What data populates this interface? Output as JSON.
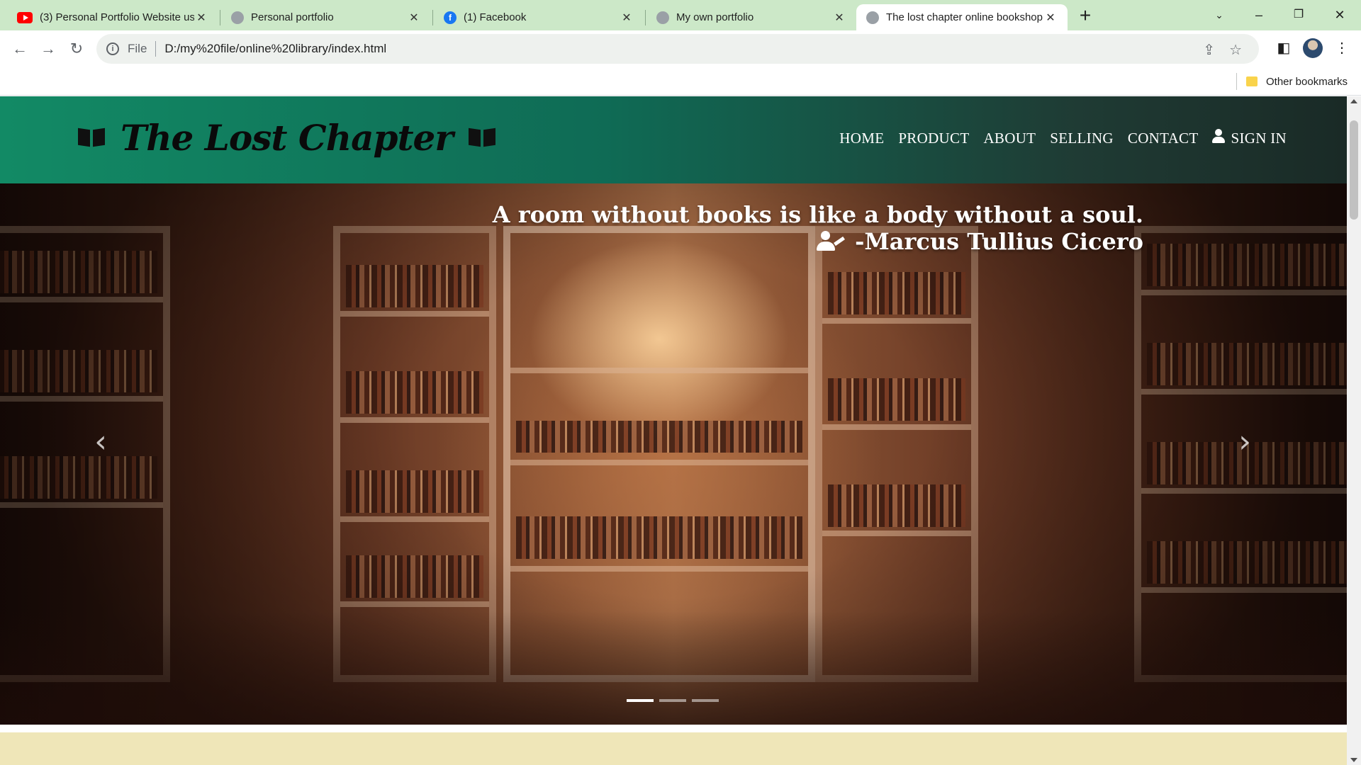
{
  "browser": {
    "tabs": [
      {
        "title": "(3) Personal Portfolio Website usi",
        "favicon": "youtube-icon",
        "active": false
      },
      {
        "title": "Personal portfolio",
        "favicon": "globe-icon",
        "active": false
      },
      {
        "title": "(1) Facebook",
        "favicon": "facebook-icon",
        "active": false
      },
      {
        "title": "My own portfolio",
        "favicon": "globe-icon",
        "active": false
      },
      {
        "title": "The lost chapter online bookshop",
        "favicon": "globe-icon",
        "active": true
      }
    ],
    "address": {
      "scheme": "File",
      "url": "D:/my%20file/online%20library/index.html"
    },
    "bookmarks": {
      "other": "Other bookmarks"
    }
  },
  "site": {
    "brand": "The Lost Chapter",
    "nav": [
      "HOME",
      "PRODUCT",
      "ABOUT",
      "SELLING",
      "CONTACT"
    ],
    "sign_in": "SIGN IN",
    "hero": {
      "quote_line1": "A room without books is like a body without a soul.",
      "quote_line2": "-Marcus Tullius Cicero",
      "prev_icon": "chevron-left-icon",
      "next_icon": "chevron-right-icon",
      "slides": 3,
      "active_slide": 1
    }
  },
  "colors": {
    "tabbar": "#cce8c8",
    "header_start": "#128a65",
    "header_end": "#1a2a26",
    "next_section": "#efe6b8"
  }
}
